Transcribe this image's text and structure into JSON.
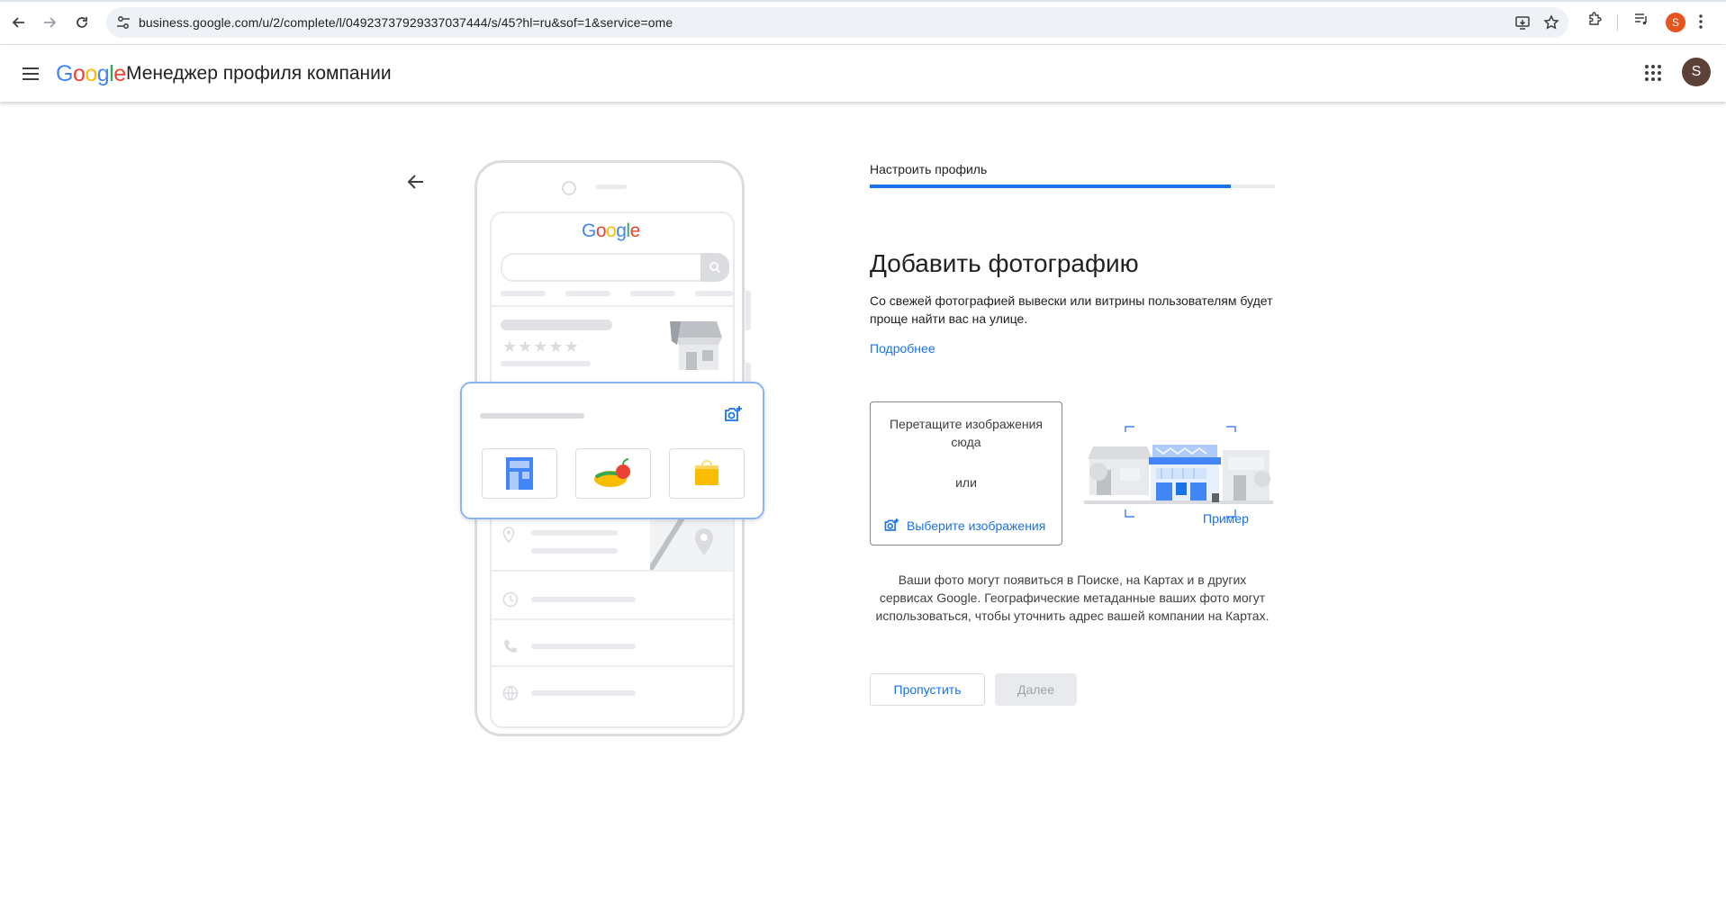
{
  "browser": {
    "url": "business.google.com/u/2/complete/l/04923737929337037444/s/45?hl=ru&sof=1&service=ome",
    "profile_initial": "S"
  },
  "app": {
    "logo_text": "Google",
    "title": "Менеджер профиля компании",
    "avatar_initial": "S"
  },
  "step": {
    "label": "Настроить профиль",
    "progress_percent": 89
  },
  "content": {
    "heading": "Добавить фотографию",
    "description": "Со свежей фотографией вывески или витрины пользователям будет проще найти вас на улице.",
    "learn_more": "Подробнее",
    "dropzone_text": "Перетащите изображения сюда",
    "or_text": "или",
    "choose_images": "Выберите изображения",
    "example_label": "Пример",
    "note": "Ваши фото могут появиться в Поиске, на Картах и в других сервисах Google. Географические метаданные ваших фото могут использоваться, чтобы уточнить адрес вашей компании на Картах."
  },
  "illustration": {
    "logo_text": "Google",
    "stars": "★★★★★"
  },
  "buttons": {
    "skip": "Пропустить",
    "next": "Далее"
  },
  "colors": {
    "accent": "#1a73e8",
    "disabled_bg": "#e8eaed",
    "avatar": "#5d4037",
    "profile_dot": "#e8541e"
  }
}
